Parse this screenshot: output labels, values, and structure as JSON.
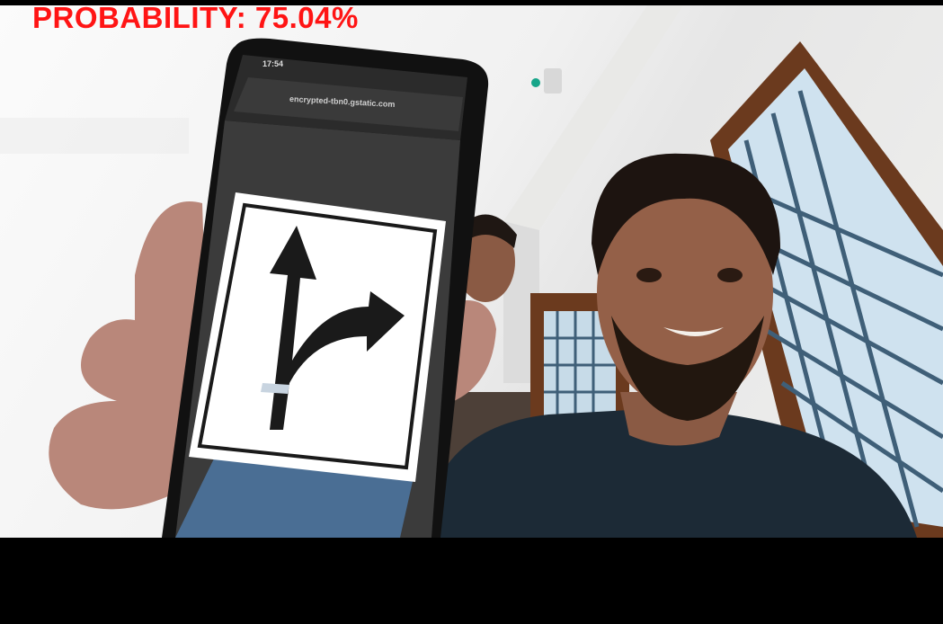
{
  "overlay": {
    "prefix": "PROBABILITY:",
    "value": "75.04%",
    "color": "#ff1414"
  },
  "phone": {
    "status_time": "17:54",
    "url": "encrypted-tbn0.gstatic.com"
  },
  "icons": {
    "sign": "traffic-sign-straight-or-right-arrow-icon"
  },
  "colors": {
    "letterbox": "#000000",
    "wall": "#f2f2f2",
    "window_frame": "#6b3a1e",
    "window_glass": "#cfe2ef"
  }
}
